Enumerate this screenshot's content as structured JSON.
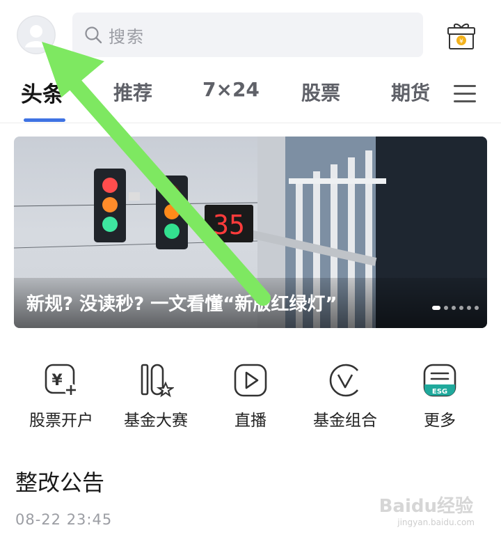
{
  "header": {
    "search_placeholder": "搜索",
    "avatar_icon": "user-avatar-icon",
    "gift_icon": "gift-box-icon"
  },
  "tabs": [
    {
      "label": "头条",
      "active": true
    },
    {
      "label": "推荐",
      "active": false
    },
    {
      "label": "7×24",
      "active": false
    },
    {
      "label": "股票",
      "active": false
    },
    {
      "label": "期货",
      "active": false
    }
  ],
  "menu_icon": "hamburger-menu-icon",
  "banner": {
    "title": "新规? 没读秒? 一文看懂“新版红绿灯”",
    "counter_number": "35",
    "dots_total": 6,
    "dots_active": 1
  },
  "quick_actions": [
    {
      "label": "股票开户",
      "icon": "stock-account-icon"
    },
    {
      "label": "基金大赛",
      "icon": "fund-contest-icon"
    },
    {
      "label": "直播",
      "icon": "live-play-icon"
    },
    {
      "label": "基金组合",
      "icon": "fund-portfolio-icon"
    },
    {
      "label": "更多",
      "icon": "esg-more-icon",
      "badge": "ESG"
    }
  ],
  "notice": {
    "title": "整改公告",
    "time": "08-22 23:45"
  },
  "watermark": {
    "text": "Baidu经验",
    "sub": "jingyan.baidu.com"
  },
  "colors": {
    "accent": "#3f73e3",
    "arrow": "#7ee861",
    "esg_teal": "#1fa99c"
  }
}
